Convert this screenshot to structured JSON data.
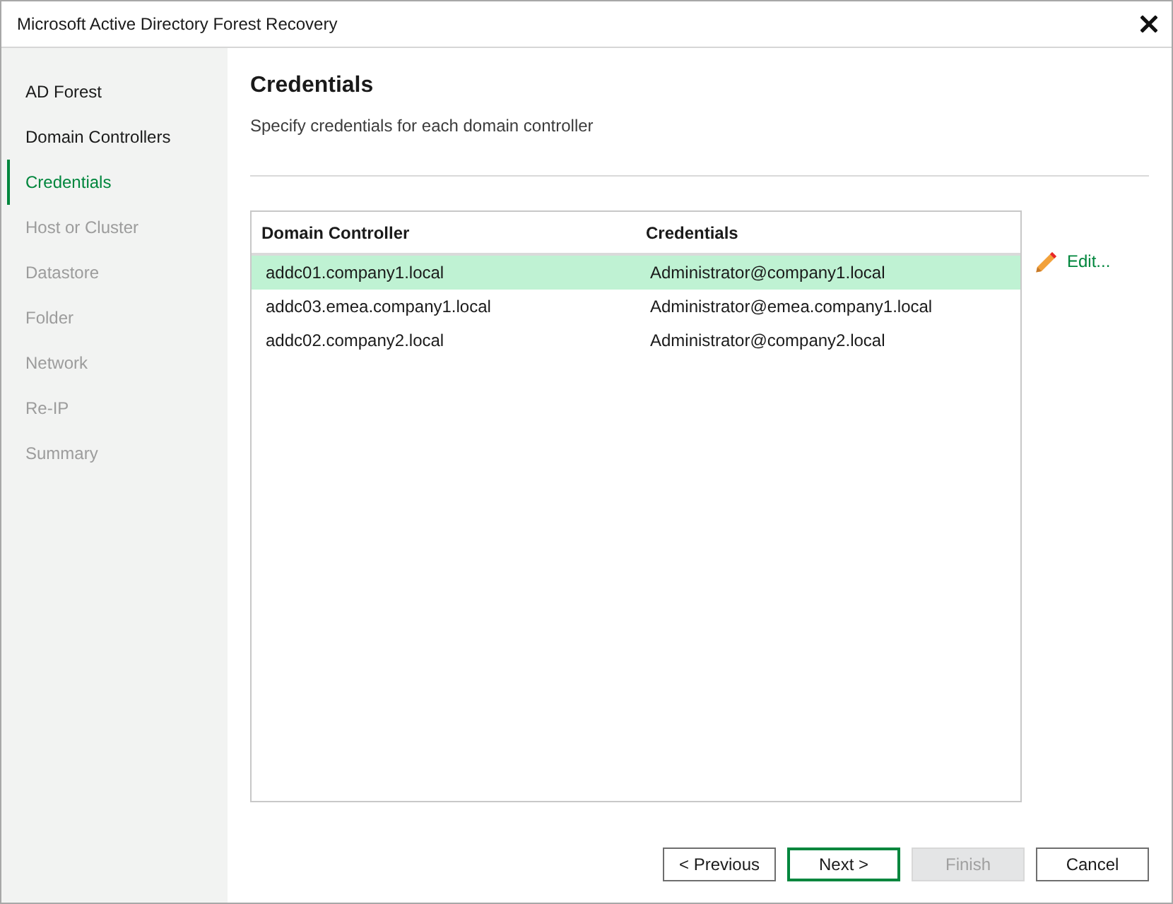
{
  "window": {
    "title": "Microsoft Active Directory Forest Recovery"
  },
  "steps": [
    {
      "label": "AD Forest",
      "selected": false,
      "disabled": false
    },
    {
      "label": "Domain Controllers",
      "selected": false,
      "disabled": false
    },
    {
      "label": "Credentials",
      "selected": true,
      "disabled": false
    },
    {
      "label": "Host or Cluster",
      "selected": false,
      "disabled": true
    },
    {
      "label": "Datastore",
      "selected": false,
      "disabled": true
    },
    {
      "label": "Folder",
      "selected": false,
      "disabled": true
    },
    {
      "label": "Network",
      "selected": false,
      "disabled": true
    },
    {
      "label": "Re-IP",
      "selected": false,
      "disabled": true
    },
    {
      "label": "Summary",
      "selected": false,
      "disabled": true
    }
  ],
  "page": {
    "title": "Credentials",
    "description": "Specify credentials for each domain controller"
  },
  "table": {
    "columns": [
      "Domain Controller",
      "Credentials"
    ],
    "rows": [
      {
        "cells": [
          "addc01.company1.local",
          "Administrator@company1.local"
        ],
        "selected": true
      },
      {
        "cells": [
          "addc03.emea.company1.local",
          "Administrator@emea.company1.local"
        ],
        "selected": false
      },
      {
        "cells": [
          "addc02.company2.local",
          "Administrator@company2.local"
        ],
        "selected": false
      }
    ]
  },
  "edit_link": {
    "label": "Edit..."
  },
  "buttons": [
    {
      "label": "< Previous",
      "default": false,
      "disabled": false
    },
    {
      "label": "Next >",
      "default": true,
      "disabled": false
    },
    {
      "label": "Finish",
      "default": false,
      "disabled": true
    },
    {
      "label": "Cancel",
      "default": false,
      "disabled": false
    }
  ]
}
